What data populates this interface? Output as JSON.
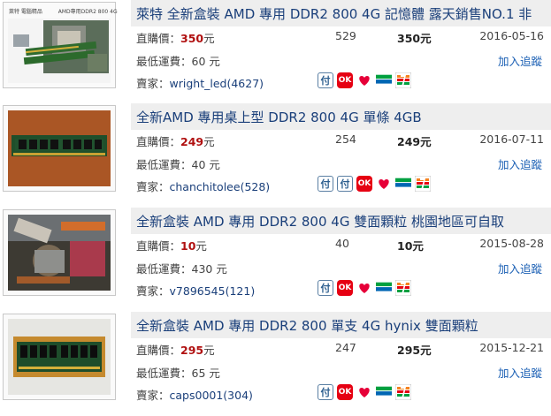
{
  "labels": {
    "direct_price": "直購價：",
    "min_shipping": "最低運費：",
    "seller": "賣家：",
    "track": "加入追蹤"
  },
  "listings": [
    {
      "title": "萊特 全新盒裝 AMD 專用 DDR2 800 4G 記憶體 露天銷售NO.1 非",
      "price": "350",
      "price_unit": "元",
      "bids": "529",
      "final_price": "350元",
      "date": "2016-05-16",
      "shipping": "60 元",
      "seller": "wright_led(4627)",
      "thumb_caption_left": "萊特 電腦精品",
      "thumb_caption_right": "AMD專用DDR2 800 4G",
      "payment_icons": [
        "pay-icon",
        "ok-mart-icon",
        "hilife-icon",
        "familymart-icon",
        "seven-eleven-icon"
      ]
    },
    {
      "title": "全新AMD 專用桌上型 DDR2 800 4G 單條 4GB",
      "price": "249",
      "price_unit": "元",
      "bids": "254",
      "final_price": "249元",
      "date": "2016-07-11",
      "shipping": "40 元",
      "seller": "chanchitolee(528)",
      "payment_icons": [
        "pay-icon",
        "pay-icon",
        "ok-mart-icon",
        "hilife-icon",
        "familymart-icon",
        "seven-eleven-icon"
      ]
    },
    {
      "title": "全新盒裝 AMD 專用 DDR2 800 4G 雙面顆粒 桃園地區可自取",
      "price": "10",
      "price_unit": "元",
      "bids": "40",
      "final_price": "10元",
      "date": "2015-08-28",
      "shipping": "430 元",
      "seller": "v7896545(121)",
      "payment_icons": [
        "pay-icon",
        "ok-mart-icon",
        "hilife-icon",
        "familymart-icon",
        "seven-eleven-icon"
      ]
    },
    {
      "title": "全新盒裝 AMD 專用 DDR2 800 單支 4G hynix 雙面顆粒",
      "price": "295",
      "price_unit": "元",
      "bids": "247",
      "final_price": "295元",
      "date": "2015-12-21",
      "shipping": "65 元",
      "seller": "caps0001(304)",
      "payment_icons": [
        "pay-icon",
        "ok-mart-icon",
        "hilife-icon",
        "familymart-icon",
        "seven-eleven-icon"
      ]
    }
  ],
  "icon_glyphs": {
    "pay": "付",
    "ok": "OK",
    "hilife_heart": "♥",
    "familymart": "FamilyMart",
    "seven": "7"
  }
}
